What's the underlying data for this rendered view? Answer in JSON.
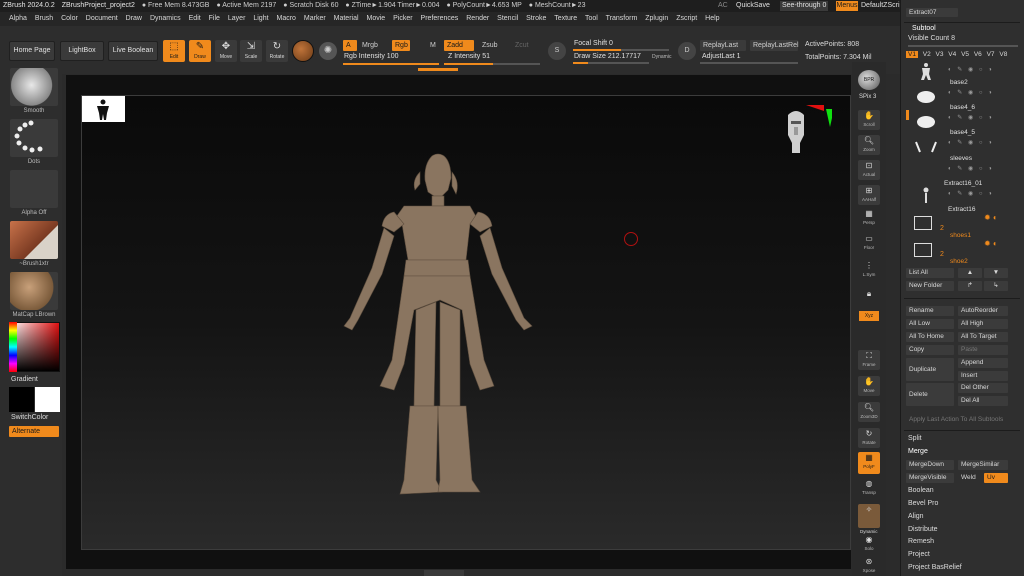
{
  "menubar": {
    "title": "ZBrush 2024.0.2",
    "project": "ZBrushProject_project2",
    "stats": [
      "● Free Mem 8.473GB",
      "● Active Mem 2197",
      "● Scratch Disk 60",
      "● ZTime►1.904 Timer►0.004",
      "● PolyCount►4.653 MP",
      "● MeshCount►23"
    ],
    "ac": "AC",
    "quicksave": "QuickSave",
    "seethrough": "See-through  0",
    "menus": "Menus",
    "script": "DefaultZScript",
    "items": [
      "Alpha",
      "Brush",
      "Color",
      "Document",
      "Draw",
      "Dynamics",
      "Edit",
      "File",
      "Layer",
      "Light",
      "Macro",
      "Marker",
      "Material",
      "Movie",
      "Picker",
      "Preferences",
      "Render",
      "Stencil",
      "Stroke",
      "Texture",
      "Tool",
      "Transform",
      "Zplugin",
      "Zscript",
      "Help"
    ]
  },
  "toolbar": {
    "home_page": "Home Page",
    "lightbox": "LightBox",
    "live_boolean": "Live Boolean",
    "edit": "Edit",
    "draw": "Draw",
    "move": "Move",
    "scale": "Scale",
    "rotate": "Rotate",
    "a_btn": "A",
    "mrgb": "Mrgb",
    "rgb": "Rgb",
    "m": "M",
    "zadd": "Zadd",
    "zsub": "Zsub",
    "zcut": "Zcut",
    "rgb_intensity": "Rgb Intensity 100",
    "z_intensity": "Z Intensity 51",
    "focal_shift": "Focal Shift 0",
    "draw_size": "Draw Size 212.17717",
    "dynamic": "Dynamic",
    "replay_last": "ReplayLast",
    "replay_last_rel": "ReplayLastRel",
    "adjust_last": "AdjustLast 1",
    "active_points": "ActivePoints: 808",
    "total_points": "TotalPoints: 7.304 Mil",
    "rgb_intensity_value": 1.0,
    "z_intensity_value": 0.51,
    "focal_shift_value": 0.5,
    "draw_size_value": 0.2
  },
  "leftshelf": {
    "brush": "Smooth",
    "stroke": "Dots",
    "alpha": "Alpha Off",
    "texture": "~Brush1xtr",
    "material": "MatCap LBrown",
    "gradient": "Gradient",
    "switch_color": "SwitchColor",
    "alternate": "Alternate"
  },
  "rightshelf": {
    "bpr": "BPR",
    "spix": "SPix 3",
    "items": [
      "Scroll",
      "Zoom",
      "Actual",
      "AAHalf",
      "Persp",
      "Floor",
      "L.Sym",
      "Xyz",
      "Frame",
      "Move",
      "Zoom3D",
      "Rotate",
      "PolyF",
      "Transp",
      "Dynamic",
      "Solo",
      "Xpose"
    ],
    "dynamic_label": "Dynamic"
  },
  "panel": {
    "extract_label": "Extract07",
    "subtool_title": "Subtool",
    "visible_count": "Visible Count 8",
    "v_tabs": [
      "V1",
      "V2",
      "V3",
      "V4",
      "V5",
      "V6",
      "V7",
      "V8"
    ],
    "subtools": [
      {
        "name": "",
        "active": false
      },
      {
        "name": "base2",
        "active": false
      },
      {
        "name": "base4_6",
        "active": false
      },
      {
        "name": "base4_5",
        "active": false
      },
      {
        "name": "sleeves",
        "active": false
      },
      {
        "name": "Extract16_01",
        "active": false
      },
      {
        "name": "Extract16",
        "active": false
      },
      {
        "name": "shoes1",
        "active": true
      },
      {
        "name": "shoe2",
        "active": true
      }
    ],
    "folder_count_1": "2",
    "folder_count_2": "2",
    "list_all": "List All",
    "new_folder": "New Folder",
    "rename": "Rename",
    "auto_reorder": "AutoReorder",
    "all_low": "All Low",
    "all_high": "All High",
    "all_to_home": "All To Home",
    "all_to_target": "All To Target",
    "copy": "Copy",
    "paste": "Paste",
    "duplicate": "Duplicate",
    "append": "Append",
    "insert": "Insert",
    "delete": "Delete",
    "del_other": "Del Other",
    "del_all": "Del All",
    "apply_last": "Apply Last Action To All Subtools",
    "split": "Split",
    "merge": "Merge",
    "merge_down": "MergeDown",
    "merge_similar": "MergeSimilar",
    "merge_visible": "MergeVisible",
    "weld": "Weld",
    "uv": "Uv",
    "boolean": "Boolean",
    "bevel_pro": "Bevel Pro",
    "align": "Align",
    "distribute": "Distribute",
    "remesh": "Remesh",
    "project": "Project",
    "project_basrelief": "Project BasRelief"
  },
  "colors": {
    "accent": "#f08a1c",
    "figure": "#8a7560",
    "background": "#2b2b2b"
  }
}
